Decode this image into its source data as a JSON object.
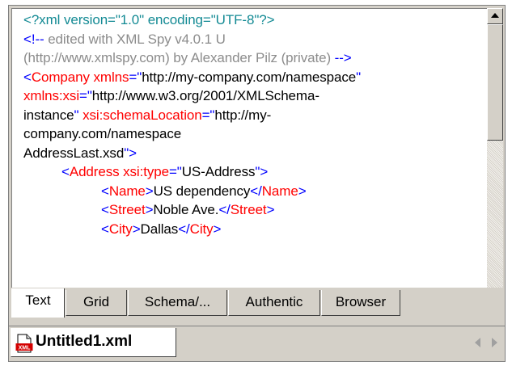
{
  "editor": {
    "lines": [
      {
        "indent": 0,
        "tokens": [
          {
            "c": "teal",
            "t": "<?xml version=\"1.0\" encoding=\"UTF-8\"?>"
          }
        ]
      },
      {
        "indent": 0,
        "tokens": [
          {
            "c": "blue",
            "t": "<!--"
          },
          {
            "c": "gray",
            "t": " edited with XML Spy v4.0.1 U"
          }
        ]
      },
      {
        "indent": 0,
        "tokens": [
          {
            "c": "gray",
            "t": "(http://www.xmlspy.com) by Alexander Pilz (private) "
          },
          {
            "c": "blue",
            "t": "-->"
          }
        ]
      },
      {
        "indent": 0,
        "tokens": [
          {
            "c": "blue",
            "t": "<"
          },
          {
            "c": "red",
            "t": "Company"
          },
          {
            "c": "blk",
            "t": " "
          },
          {
            "c": "red",
            "t": "xmlns"
          },
          {
            "c": "blue",
            "t": "=\""
          },
          {
            "c": "blk",
            "t": "http://my-company.com/namespace"
          },
          {
            "c": "blue",
            "t": "\""
          }
        ]
      },
      {
        "indent": 0,
        "tokens": [
          {
            "c": "red",
            "t": "xmlns:xsi"
          },
          {
            "c": "blue",
            "t": "=\""
          },
          {
            "c": "blk",
            "t": "http://www.w3.org/2001/XMLSchema-"
          }
        ]
      },
      {
        "indent": 0,
        "tokens": [
          {
            "c": "blk",
            "t": "instance"
          },
          {
            "c": "blue",
            "t": "\""
          },
          {
            "c": "blk",
            "t": " "
          },
          {
            "c": "red",
            "t": "xsi:schemaLocation"
          },
          {
            "c": "blue",
            "t": "=\""
          },
          {
            "c": "blk",
            "t": "http://my-"
          }
        ]
      },
      {
        "indent": 0,
        "tokens": [
          {
            "c": "blk",
            "t": "company.com/namespace"
          }
        ]
      },
      {
        "indent": 0,
        "tokens": [
          {
            "c": "blk",
            "t": "AddressLast.xsd"
          },
          {
            "c": "blue",
            "t": "\">"
          }
        ]
      },
      {
        "indent": 1,
        "tokens": [
          {
            "c": "blue",
            "t": "<"
          },
          {
            "c": "red",
            "t": "Address"
          },
          {
            "c": "blk",
            "t": " "
          },
          {
            "c": "red",
            "t": "xsi:type"
          },
          {
            "c": "blue",
            "t": "=\""
          },
          {
            "c": "blk",
            "t": "US-Address"
          },
          {
            "c": "blue",
            "t": "\">"
          }
        ]
      },
      {
        "indent": 2,
        "tokens": [
          {
            "c": "blue",
            "t": "<"
          },
          {
            "c": "red",
            "t": "Name"
          },
          {
            "c": "blue",
            "t": ">"
          },
          {
            "c": "blk",
            "t": "US dependency"
          },
          {
            "c": "blue",
            "t": "</"
          },
          {
            "c": "red",
            "t": "Name"
          },
          {
            "c": "blue",
            "t": ">"
          }
        ]
      },
      {
        "indent": 2,
        "tokens": [
          {
            "c": "blue",
            "t": "<"
          },
          {
            "c": "red",
            "t": "Street"
          },
          {
            "c": "blue",
            "t": ">"
          },
          {
            "c": "blk",
            "t": "Noble Ave."
          },
          {
            "c": "blue",
            "t": "</"
          },
          {
            "c": "red",
            "t": "Street"
          },
          {
            "c": "blue",
            "t": ">"
          }
        ]
      },
      {
        "indent": 2,
        "tokens": [
          {
            "c": "blue",
            "t": "<"
          },
          {
            "c": "red",
            "t": "City"
          },
          {
            "c": "blue",
            "t": ">"
          },
          {
            "c": "blk",
            "t": "Dallas"
          },
          {
            "c": "blue",
            "t": "</"
          },
          {
            "c": "red",
            "t": "City"
          },
          {
            "c": "blue",
            "t": ">"
          }
        ]
      }
    ]
  },
  "view_tabs": [
    {
      "label": "Text",
      "active": true
    },
    {
      "label": "Grid",
      "active": false
    },
    {
      "label": "Schema/...",
      "active": false
    },
    {
      "label": "Authentic",
      "active": false
    },
    {
      "label": "Browser",
      "active": false
    }
  ],
  "document_tab": {
    "label": "Untitled1.xml",
    "icon": "xml-file-icon",
    "icon_text": "XML"
  },
  "colors": {
    "teal": "#138a94",
    "gray": "#8c8c8c",
    "blue": "#0000ff",
    "red": "#ff0000",
    "black": "#000000"
  }
}
